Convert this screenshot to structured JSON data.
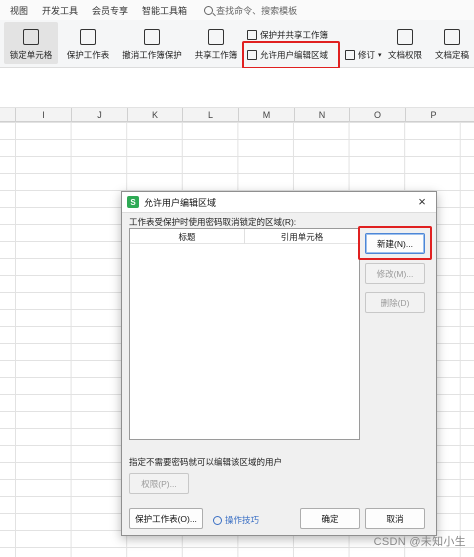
{
  "menu": {
    "tabs": [
      "视图",
      "开发工具",
      "会员专享",
      "智能工具箱"
    ],
    "search_placeholder": "查找命令、搜索模板"
  },
  "ribbon": {
    "lock_cell": "锁定单元格",
    "protect_sheet": "保护工作表",
    "unprotect_workbook": "撤消工作簿保护",
    "share_workbook": "共享工作簿",
    "protect_and_share": "保护并共享工作簿",
    "allow_edit_ranges": "允许用户编辑区域",
    "track_changes": "修订",
    "doc_permissions": "文档权限",
    "doc_finalize": "文档定稿",
    "highlight_color": "#e02020"
  },
  "sheet": {
    "columns": [
      "I",
      "J",
      "K",
      "L",
      "M",
      "N",
      "O",
      "P"
    ]
  },
  "dialog": {
    "title": "允许用户编辑区域",
    "instruction": "工作表受保护时使用密码取消锁定的区域(R):",
    "col_title": "标题",
    "col_ref": "引用单元格",
    "new_button": "新建(N)...",
    "modify_button": "修改(M)...",
    "delete_button": "删除(D)",
    "no_password_label": "指定不需要密码就可以编辑该区域的用户",
    "permissions_button": "权限(P)...",
    "protect_sheet_button": "保护工作表(O)...",
    "tips_link": "操作技巧",
    "ok_button": "确定",
    "cancel_button": "取消"
  },
  "watermark": "CSDN @未知小生"
}
